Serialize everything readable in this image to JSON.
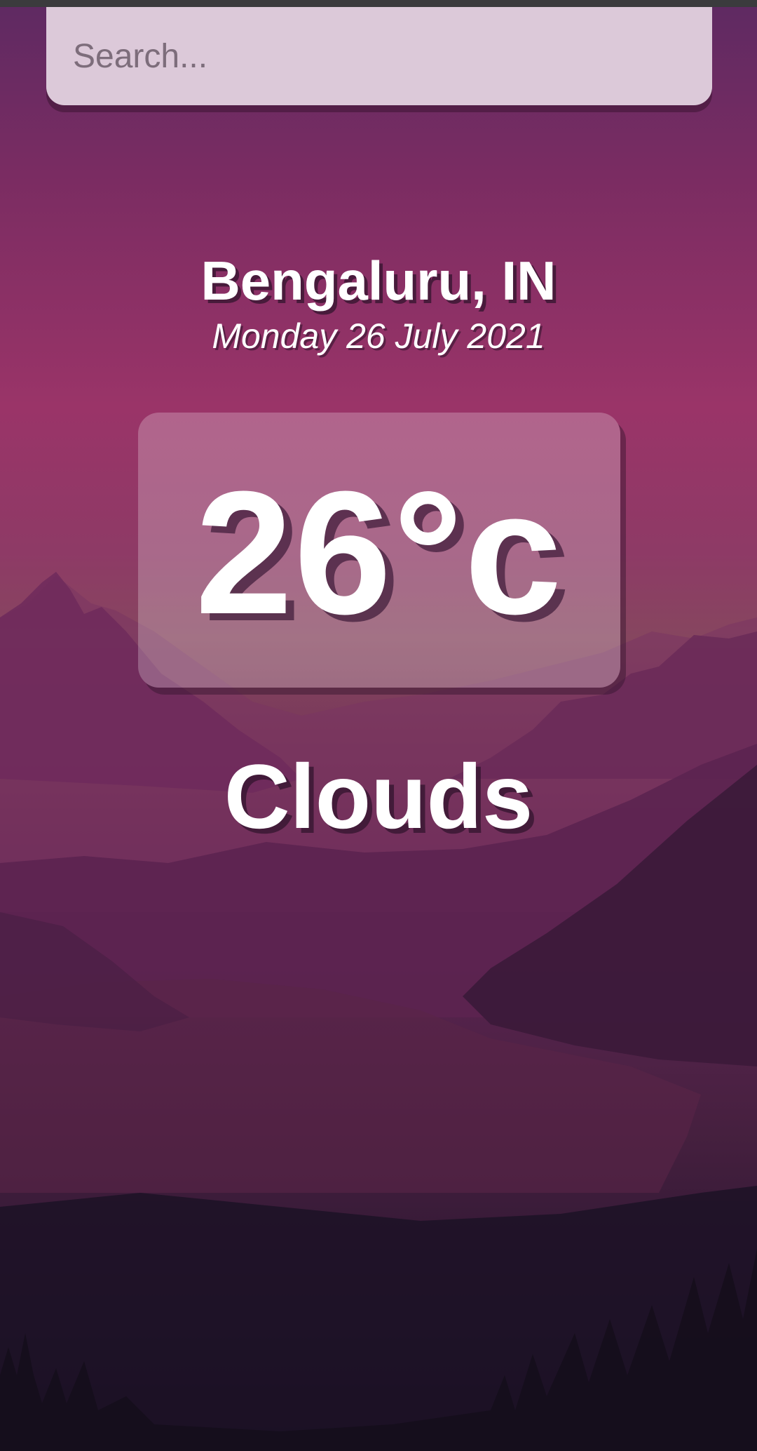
{
  "search": {
    "placeholder": "Search...",
    "value": ""
  },
  "weather": {
    "location": "Bengaluru, IN",
    "date": "Monday 26 July 2021",
    "temperature": "26°c",
    "condition": "Clouds"
  },
  "colors": {
    "background_top": "#5e2a62",
    "background_mid": "#9a3468",
    "background_bottom": "#17101f",
    "search_box": "#dcc9d9",
    "text": "#ffffff"
  },
  "background_image": "mountain-lake-sunset-illustration"
}
